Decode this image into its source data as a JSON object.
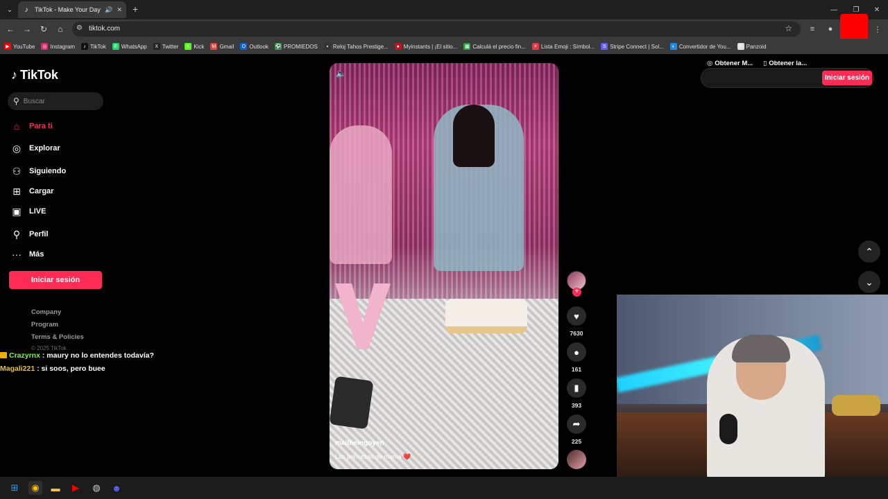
{
  "browser": {
    "tab_title": "TikTok - Make Your Day",
    "url": "tiktok.com",
    "bookmarks": [
      {
        "label": "YouTube",
        "color": "#ff0000",
        "glyph": "▶"
      },
      {
        "label": "Instagram",
        "color": "#d62976",
        "glyph": "◎"
      },
      {
        "label": "TikTok",
        "color": "#111111",
        "glyph": "♪"
      },
      {
        "label": "WhatsApp",
        "color": "#25d366",
        "glyph": "✆"
      },
      {
        "label": "Twitter",
        "color": "#222222",
        "glyph": "X"
      },
      {
        "label": "Kick",
        "color": "#53fc18",
        "glyph": "K"
      },
      {
        "label": "Gmail",
        "color": "#ea4335",
        "glyph": "M"
      },
      {
        "label": "Outlook",
        "color": "#0a64d8",
        "glyph": "O"
      },
      {
        "label": "PROMIEDOS",
        "color": "#2ea043",
        "glyph": "⚽"
      },
      {
        "label": "Reloj Tahos Prestige...",
        "color": "#333333",
        "glyph": "▪"
      },
      {
        "label": "Myinstants | ¡El sitio...",
        "color": "#c1121f",
        "glyph": "●"
      },
      {
        "label": "Calculá el precio fin...",
        "color": "#2e9e46",
        "glyph": "▦"
      },
      {
        "label": "Lista Emoji : Símbol...",
        "color": "#e63946",
        "glyph": "⚡"
      },
      {
        "label": "Stripe Connect | Sol...",
        "color": "#635bff",
        "glyph": "S"
      },
      {
        "label": "Convertidor de You...",
        "color": "#1e88e5",
        "glyph": "◐"
      },
      {
        "label": "Panzoid",
        "color": "#dddddd",
        "glyph": "P"
      }
    ]
  },
  "sidebar": {
    "logo": "TikTok",
    "search_placeholder": "Buscar",
    "nav": [
      {
        "label": "Para ti",
        "icon": "home-icon",
        "glyph": "⌂",
        "active": true
      },
      {
        "label": "Explorar",
        "icon": "compass-icon",
        "glyph": "◎"
      },
      {
        "label": "Siguiendo",
        "icon": "following-icon",
        "glyph": "⚇"
      },
      {
        "label": "Cargar",
        "icon": "upload-icon",
        "glyph": "⊞"
      },
      {
        "label": "LIVE",
        "icon": "live-icon",
        "glyph": "▣"
      },
      {
        "label": "Perfil",
        "icon": "profile-icon",
        "glyph": "⚲"
      },
      {
        "label": "Más",
        "icon": "more-icon",
        "glyph": "···"
      }
    ],
    "login_label": "Iniciar sesión",
    "footer": [
      "Company",
      "Program",
      "Terms & Policies"
    ],
    "copyright": "© 2025 TikTok"
  },
  "chat": [
    {
      "user": "Crazyrnx",
      "message": ": maury no lo entendes todavía?"
    },
    {
      "user": "Magali221",
      "message": ": si soos, pero buee"
    }
  ],
  "video": {
    "author": "maitheingoyen",
    "caption": "Las princesas de mamá ❤️",
    "likes": "7630",
    "comments": "161",
    "saves": "393",
    "shares": "225"
  },
  "header": {
    "get_app_label": "Obtener M...",
    "get_desktop_label": "Obtener la...",
    "login_label": "Iniciar sesión"
  },
  "colors": {
    "accent": "#fe2c55"
  }
}
